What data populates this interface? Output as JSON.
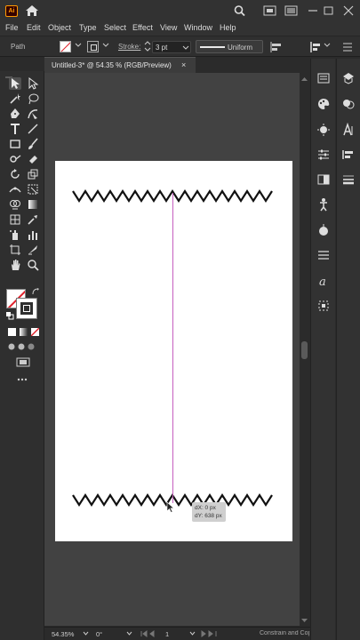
{
  "app": {
    "logo": "Ai"
  },
  "titlebar": {
    "icons": [
      "home-icon",
      "search-icon",
      "arrange-documents-icon",
      "minimize-icon",
      "restore-icon",
      "close-icon"
    ]
  },
  "menu": [
    "File",
    "Edit",
    "Object",
    "Type",
    "Select",
    "Effect",
    "View",
    "Window",
    "Help"
  ],
  "control": {
    "selection_label": "Path",
    "stroke_label": "Stroke:",
    "stroke_value": "3 pt",
    "profile_label": "Uniform"
  },
  "document": {
    "tab_title": "Untitled-3* @ 54.35 % (RGB/Preview)",
    "close": "×"
  },
  "tooltip": {
    "dx": "dX: 0 px",
    "dy": "dY: 638 px"
  },
  "status": {
    "zoom": "54.35%",
    "angle": "0°",
    "page": "1",
    "text": "Constrain and Copy"
  },
  "colors": {
    "accent_guide": "#c65fc0",
    "artboard": "#ffffff",
    "background": "#2b2b2b",
    "logo": "#ff9a00"
  }
}
